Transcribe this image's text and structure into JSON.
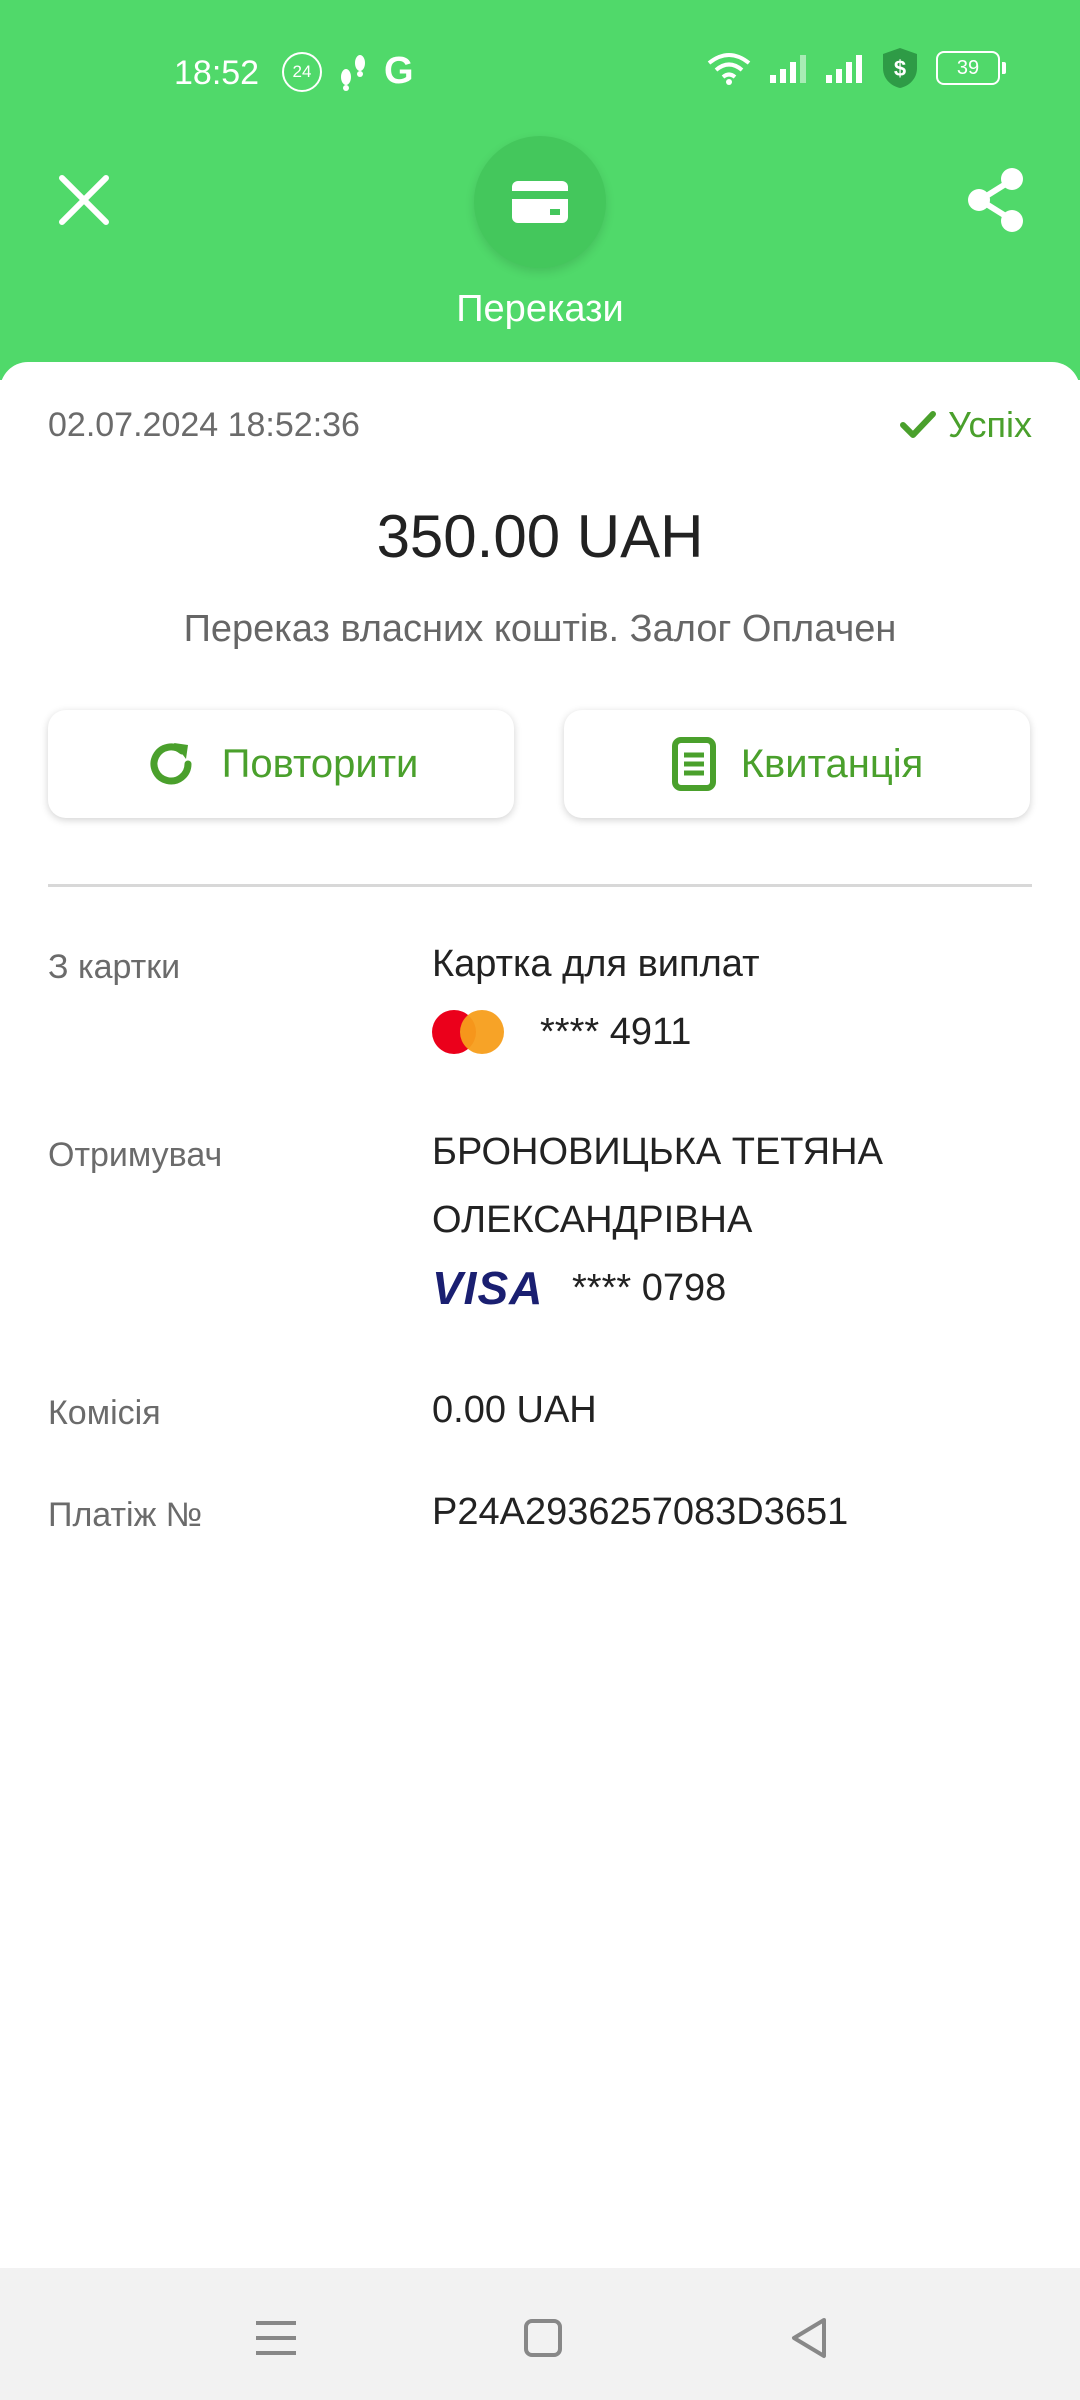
{
  "status_bar": {
    "time": "18:52",
    "notification_badge": "24",
    "google_icon": "G",
    "battery": "39"
  },
  "header": {
    "category": "Перекази",
    "close_icon": "close-icon",
    "share_icon": "share-icon",
    "category_icon": "credit-card-icon"
  },
  "transaction": {
    "datetime": "02.07.2024 18:52:36",
    "status": "Успіх",
    "amount": "350.00 UAH",
    "description": "Переказ власних коштів. Залог Оплачен"
  },
  "actions": {
    "repeat_label": "Повторити",
    "receipt_label": "Квитанція"
  },
  "details": {
    "from": {
      "label": "З картки",
      "card_name": "Картка для виплат",
      "card_number": "**** 4911"
    },
    "recipient": {
      "label": "Отримувач",
      "name_line1": "БРОНОВИЦЬКА ТЕТЯНА",
      "name_line2": "ОЛЕКСАНДРІВНА",
      "card_brand": "VISA",
      "card_number": "**** 0798"
    },
    "commission": {
      "label": "Комісія",
      "value": "0.00 UAH"
    },
    "payment_no": {
      "label": "Платіж №",
      "value": "P24A2936257083D3651"
    }
  },
  "colors": {
    "header_green": "#50d96a",
    "accent_green": "#4aa02c"
  }
}
